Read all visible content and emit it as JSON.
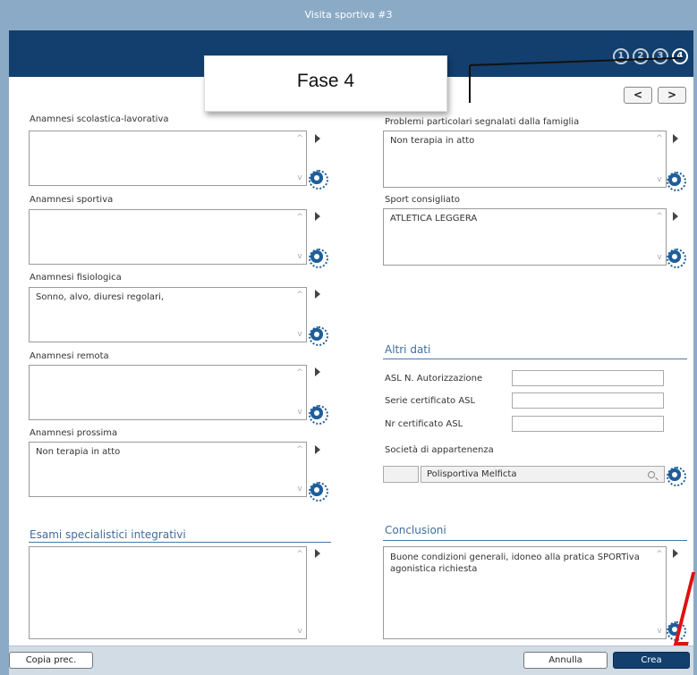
{
  "window": {
    "title": "Visita sportiva #3"
  },
  "steps": [
    "1",
    "2",
    "3",
    "4"
  ],
  "callout": {
    "text": "Fase 4"
  },
  "nav": {
    "prev": "<",
    "next": ">"
  },
  "left_fields": [
    {
      "label": "Anamnesi scolastica-lavorativa",
      "value": ""
    },
    {
      "label": "Anamnesi sportiva",
      "value": ""
    },
    {
      "label": "Anamnesi fisiologica",
      "value": "Sonno, alvo, diuresi regolari,"
    },
    {
      "label": "Anamnesi remota",
      "value": ""
    },
    {
      "label": "Anamnesi prossima",
      "value": "Non terapia in atto"
    }
  ],
  "right_fields": [
    {
      "label": "Problemi particolari segnalati dalla famiglia",
      "value": "Non terapia in atto"
    },
    {
      "label": "Sport consigliato",
      "value": "ATLETICA LEGGERA"
    }
  ],
  "altri_dati": {
    "title": "Altri dati",
    "asl_autorizzazione": {
      "label": "ASL N. Autorizzazione",
      "value": ""
    },
    "serie_certificato": {
      "label": "Serie certificato ASL",
      "value": ""
    },
    "nr_certificato": {
      "label": "Nr certificato ASL",
      "value": ""
    },
    "societa": {
      "label": "Società di appartenenza",
      "code": "",
      "value": "Polisportiva Melficta"
    }
  },
  "esami": {
    "title": "Esami specialistici integrativi",
    "value": ""
  },
  "conclusioni": {
    "title": "Conclusioni",
    "value": "Buone condizioni generali, idoneo alla pratica SPORTiva agonistica richiesta"
  },
  "footer": {
    "copy_label": "Copia prec.",
    "cancel_label": "Annulla",
    "create_label": "Crea"
  },
  "colors": {
    "header": "#123f6e",
    "titlebar": "#8aaac6",
    "accent": "#1f5e9a"
  }
}
